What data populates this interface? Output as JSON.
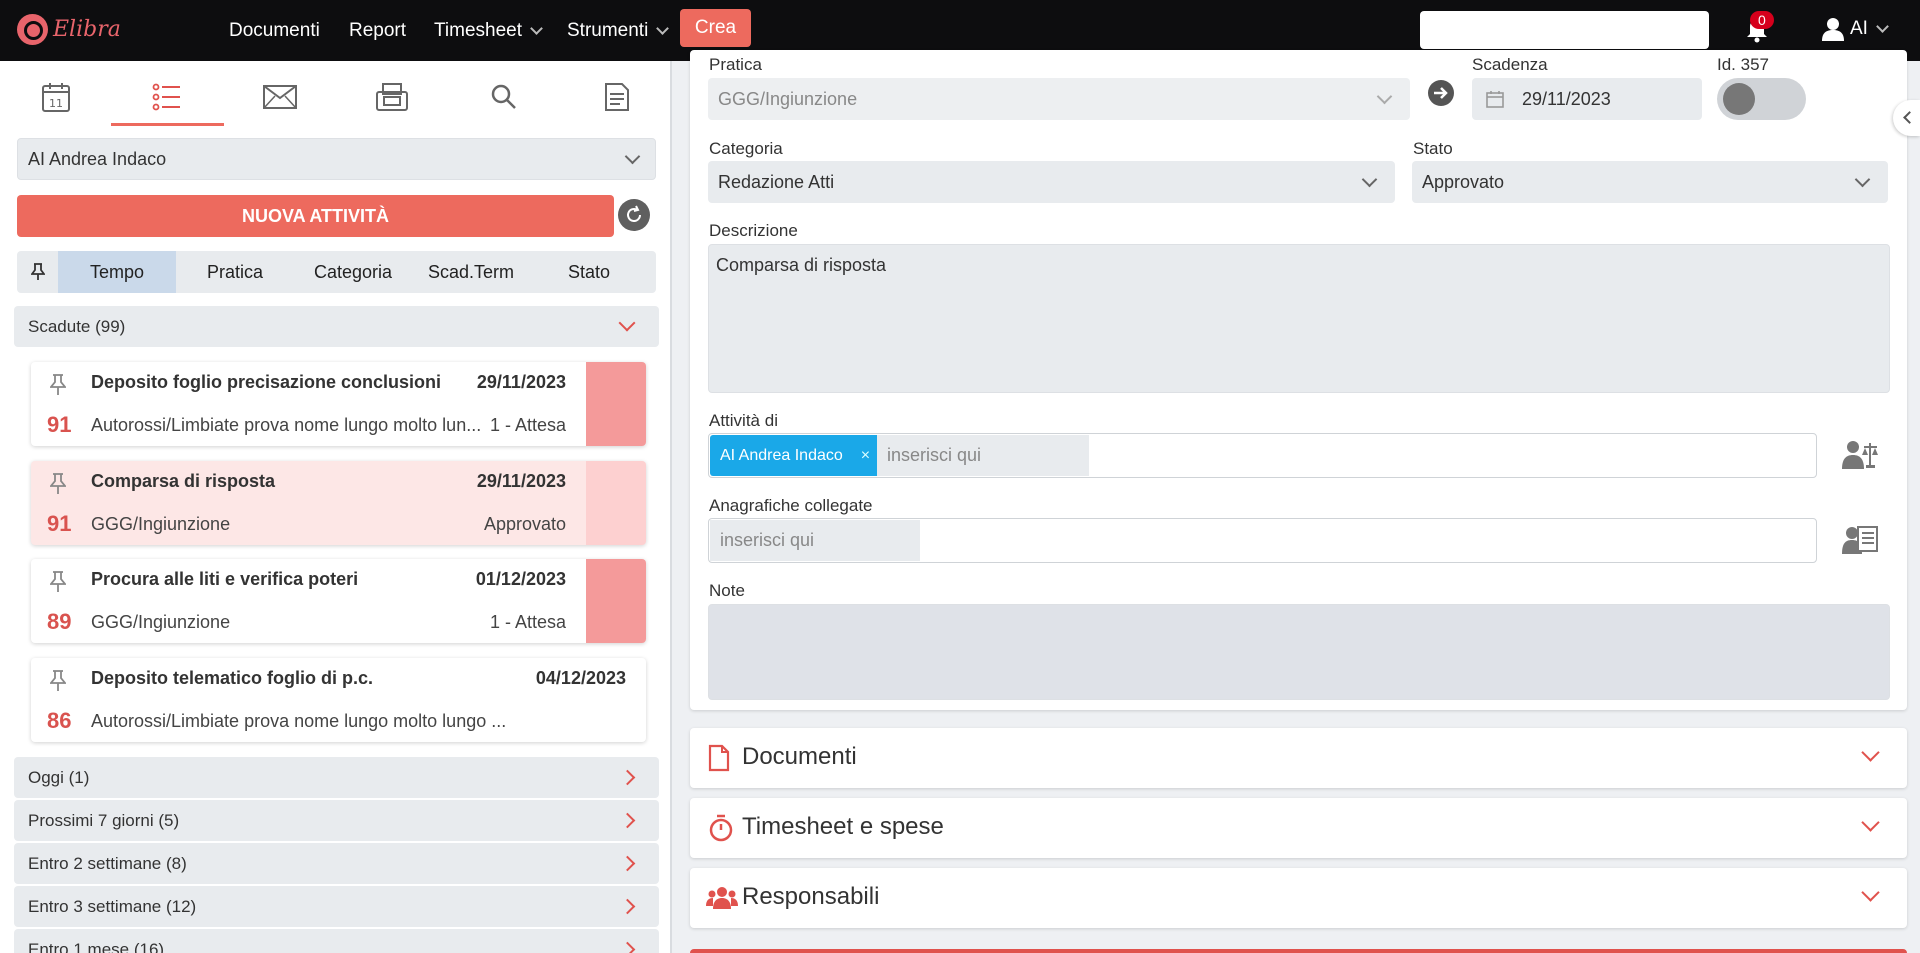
{
  "app": {
    "name": "Elibra"
  },
  "topnav": {
    "items": [
      {
        "label": "Documenti",
        "has_caret": false
      },
      {
        "label": "Report",
        "has_caret": false
      },
      {
        "label": "Timesheet",
        "has_caret": true
      },
      {
        "label": "Strumenti",
        "has_caret": true
      }
    ],
    "create_label": "Crea",
    "notifications_count": "0",
    "user_initials": "AI"
  },
  "left": {
    "toolbar_icons": [
      "calendar-icon",
      "list-icon",
      "envelope-icon",
      "fax-icon",
      "search-icon",
      "report-icon"
    ],
    "active_tool": "list-icon",
    "user_select": "AI Andrea Indaco",
    "new_activity_label": "NUOVA ATTIVITÀ",
    "sort_tabs": [
      "Tempo",
      "Pratica",
      "Categoria",
      "Scad.Term",
      "Stato"
    ],
    "active_sort": "Tempo",
    "expanded_group": "Scadute (99)",
    "cards": [
      {
        "title": "Deposito foglio precisazione conclusioni",
        "date": "29/11/2023",
        "num": "91",
        "sub": "Autorossi/Limbiate prova nome lungo molto lun...",
        "status": "1 - Attesa",
        "color": "#f49a9a",
        "selected": false
      },
      {
        "title": "Comparsa di risposta",
        "date": "29/11/2023",
        "num": "91",
        "sub": "GGG/Ingiunzione",
        "status": "Approvato",
        "color": "#fdd0d0",
        "selected": true
      },
      {
        "title": "Procura alle liti e verifica poteri",
        "date": "01/12/2023",
        "num": "89",
        "sub": "GGG/Ingiunzione",
        "status": "1 - Attesa",
        "color": "#f49a9a",
        "selected": false
      },
      {
        "title": "Deposito telematico foglio di p.c.",
        "date": "04/12/2023",
        "num": "86",
        "sub": "Autorossi/Limbiate prova nome lungo molto lungo ...",
        "status": "",
        "color": "",
        "selected": false
      }
    ],
    "collapsed_groups": [
      "Oggi (1)",
      "Prossimi 7 giorni (5)",
      "Entro 2 settimane (8)",
      "Entro 3 settimane (12)",
      "Entro 1 mese (16)"
    ]
  },
  "form": {
    "pratica_label": "Pratica",
    "pratica_value": "GGG/Ingiunzione",
    "scadenza_label": "Scadenza",
    "scadenza_value": "29/11/2023",
    "id_label": "Id. 357",
    "categoria_label": "Categoria",
    "categoria_value": "Redazione Atti",
    "stato_label": "Stato",
    "stato_value": "Approvato",
    "descrizione_label": "Descrizione",
    "descrizione_value": "Comparsa di risposta",
    "attivita_label": "Attività di",
    "attivita_chip": "AI Andrea Indaco",
    "attivita_chip_remove": "×",
    "attivita_placeholder": "inserisci qui",
    "anagrafiche_label": "Anagrafiche collegate",
    "anagrafiche_placeholder": "inserisci qui",
    "note_label": "Note",
    "note_value": ""
  },
  "accordions": [
    {
      "title": "Documenti",
      "icon": "file-icon"
    },
    {
      "title": "Timesheet e spese",
      "icon": "stopwatch-icon"
    },
    {
      "title": "Responsabili",
      "icon": "users-icon"
    }
  ],
  "colors": {
    "accent": "#ed6a5e",
    "chip": "#1aa8e8",
    "topbar": "#0d0d0f",
    "badge": "#d6001c"
  }
}
